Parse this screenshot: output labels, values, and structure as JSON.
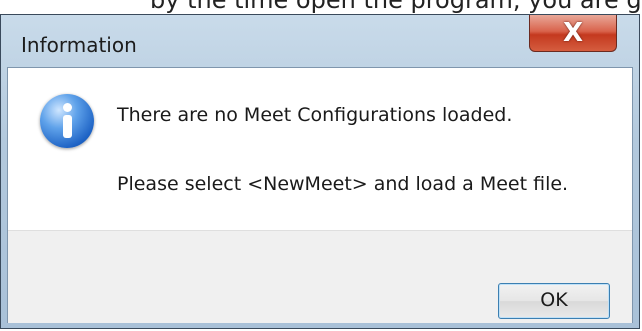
{
  "window": {
    "title": "Information",
    "close_label": "X",
    "top_strip_text": "by the time open the program, you are getting"
  },
  "message": {
    "line1": "There are no Meet Configurations loaded.",
    "line2": "Please select <NewMeet> and load a Meet file."
  },
  "buttons": {
    "ok_label": "OK"
  },
  "icons": {
    "info": "info-icon",
    "close": "close-icon"
  }
}
